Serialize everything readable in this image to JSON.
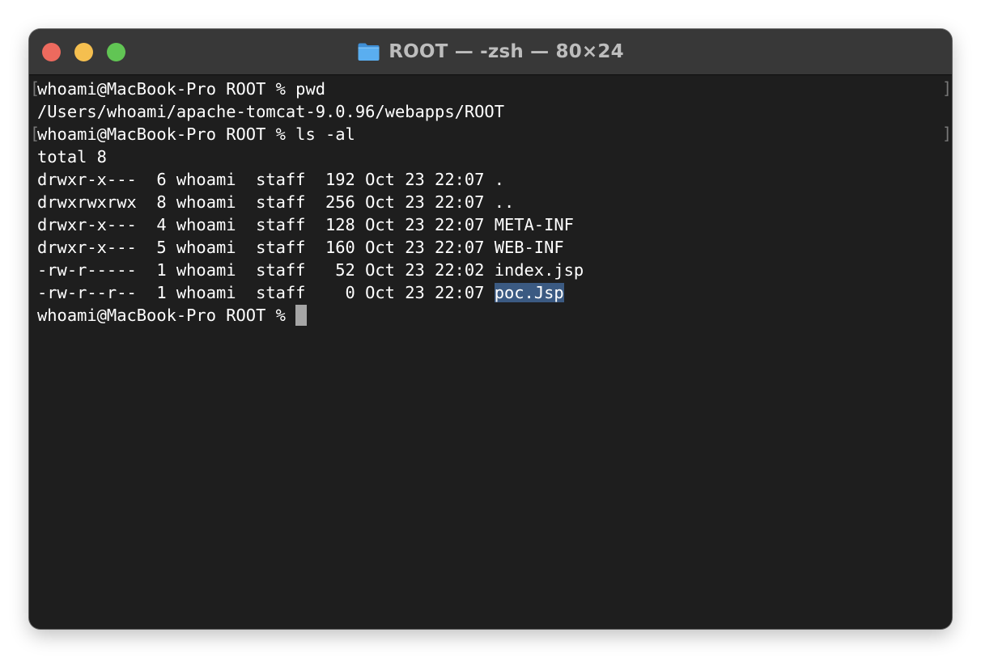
{
  "window": {
    "title": "ROOT — -zsh — 80×24",
    "title_icon": "folder-icon",
    "traffic_lights": {
      "close_color": "#ed6a5e",
      "minimize_color": "#f5bf4f",
      "zoom_color": "#61c554"
    }
  },
  "terminal": {
    "background": "#1e1e1e",
    "text_color": "#ffffff",
    "selection_color": "#3b5a82",
    "bracket_left": "[",
    "bracket_right": "]",
    "lines": [
      "whoami@MacBook-Pro ROOT % pwd",
      "/Users/whoami/apache-tomcat-9.0.96/webapps/ROOT",
      "whoami@MacBook-Pro ROOT % ls -al",
      "total 8",
      "drwxr-x---  6 whoami  staff  192 Oct 23 22:07 .",
      "drwxrwxrwx  8 whoami  staff  256 Oct 23 22:07 ..",
      "drwxr-x---  4 whoami  staff  128 Oct 23 22:07 META-INF",
      "drwxr-x---  5 whoami  staff  160 Oct 23 22:07 WEB-INF",
      "-rw-r-----  1 whoami  staff   52 Oct 23 22:02 index.jsp"
    ],
    "last_listing_prefix": "-rw-r--r--  1 whoami  staff    0 Oct 23 22:07 ",
    "last_listing_selected": "poc.Jsp",
    "current_prompt": "whoami@MacBook-Pro ROOT % "
  }
}
